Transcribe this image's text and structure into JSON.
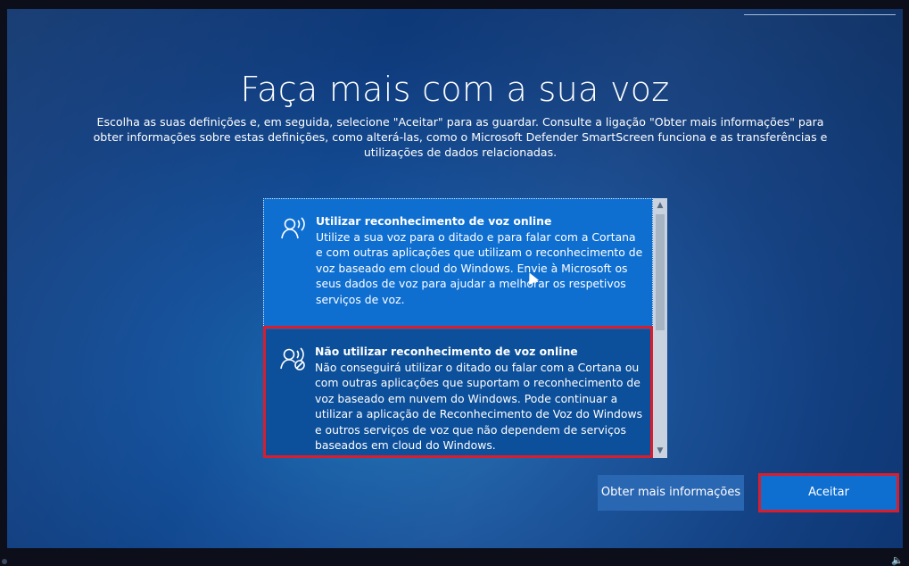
{
  "page": {
    "title": "Faça mais com a sua voz",
    "description": "Escolha as suas definições e, em seguida, selecione \"Aceitar\" para as guardar. Consulte a ligação \"Obter mais informações\" para obter informações sobre estas definições, como alterá-las, como o Microsoft Defender SmartScreen funciona e as transferências e utilizações de dados relacionadas."
  },
  "options": [
    {
      "title": "Utilizar reconhecimento de voz online",
      "body": "Utilize a sua voz para o ditado e para falar com a Cortana e com outras aplicações que utilizam o reconhecimento de voz baseado em cloud do Windows. Envie à Microsoft os seus dados de voz para ajudar a melhorar os respetivos serviços de voz.",
      "icon": "speech-icon"
    },
    {
      "title": "Não utilizar reconhecimento de voz online",
      "body": "Não conseguirá utilizar o ditado ou falar com a Cortana ou com outras aplicações que suportam o reconhecimento de voz baseado em nuvem do Windows. Pode continuar a utilizar a aplicação de Reconhecimento de Voz do Windows e outros serviços de voz que não dependem de serviços baseados em cloud do Windows.",
      "icon": "speech-off-icon"
    }
  ],
  "buttons": {
    "info": "Obter mais informações",
    "accept": "Aceitar"
  },
  "colors": {
    "background": "#0f3c7e",
    "option_selected": "#0f6fd1",
    "option_dark": "#0c4f9a",
    "highlight_border": "#d81e2e"
  }
}
